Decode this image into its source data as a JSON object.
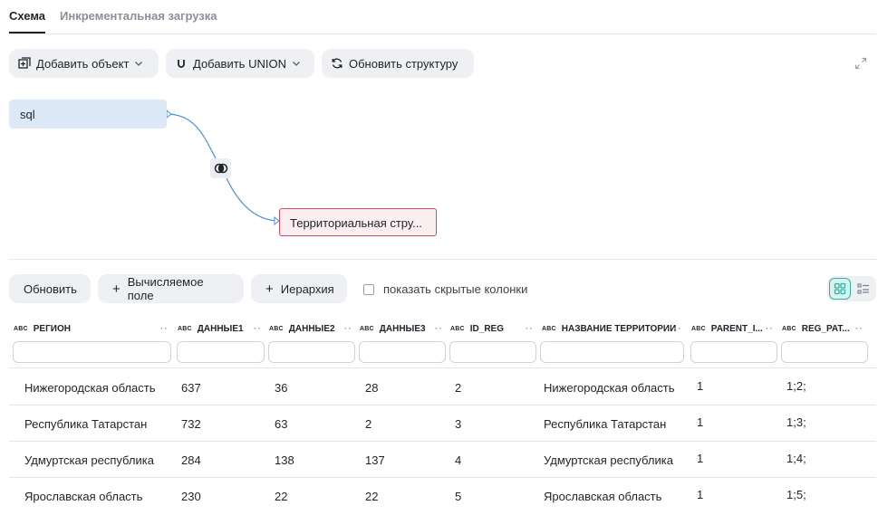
{
  "tabs": [
    {
      "label": "Схема",
      "active": true
    },
    {
      "label": "Инкрементальная загрузка",
      "active": false
    }
  ],
  "toolbar": {
    "add_object": "Добавить объект",
    "add_union": "Добавить UNION",
    "refresh_structure": "Обновить структуру"
  },
  "diagram": {
    "source_node": "sql",
    "target_node": "Территориальная стру..."
  },
  "actions": {
    "refresh": "Обновить",
    "computed_field": "Вычисляемое поле",
    "hierarchy": "Иерархия",
    "show_hidden": "показать скрытые колонки"
  },
  "table": {
    "type_badge": "ABC",
    "columns": [
      "РЕГИОН",
      "ДАННЫЕ1",
      "ДАННЫЕ2",
      "ДАННЫЕ3",
      "ID_REG",
      "НАЗВАНИЕ ТЕРРИТОРИИ",
      "PARENT_I...",
      "REG_PAT..."
    ],
    "rows": [
      [
        "Нижегородская область",
        "637",
        "36",
        "28",
        "2",
        "Нижегородская область",
        "1",
        "1;2;"
      ],
      [
        "Республика Татарстан",
        "732",
        "63",
        "2",
        "3",
        "Республика Татарстан",
        "1",
        "1;3;"
      ],
      [
        "Удмуртская республика",
        "284",
        "138",
        "137",
        "4",
        "Удмуртская республика",
        "1",
        "1;4;"
      ],
      [
        "Ярославская область",
        "230",
        "22",
        "22",
        "5",
        "Ярославская область",
        "1",
        "1;5;"
      ]
    ]
  },
  "colors": {
    "accent_teal": "#2fb4a6",
    "node_blue": "#dde9f6",
    "node_error_border": "#d9485f",
    "edge_blue": "#4a90e2"
  }
}
